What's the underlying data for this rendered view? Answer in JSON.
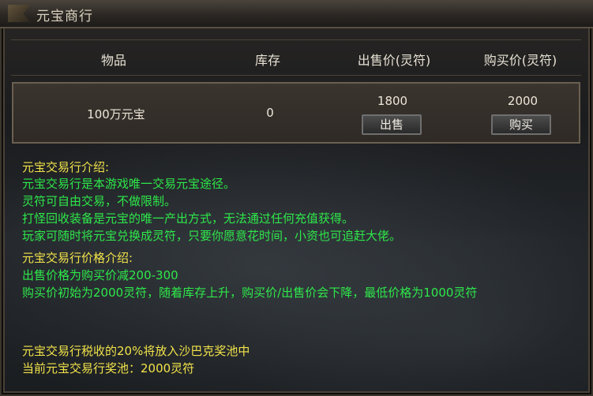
{
  "window": {
    "title": "元宝商行"
  },
  "table": {
    "headers": {
      "item": "物品",
      "stock": "库存",
      "sell_price": "出售价(灵符)",
      "buy_price": "购买价(灵符)"
    },
    "row": {
      "item": "100万元宝",
      "stock": "0",
      "sell_price": "1800",
      "buy_price": "2000",
      "sell_button": "出售",
      "buy_button": "购买"
    }
  },
  "intro": {
    "title": "元宝交易行介绍:",
    "lines": [
      "元宝交易行是本游戏唯一交易元宝途径。",
      "灵符可自由交易，不做限制。",
      "打怪回收装备是元宝的唯一产出方式，无法通过任何充值获得。",
      "玩家可随时将元宝兑换成灵符，只要你愿意花时间，小资也可追赶大佬。"
    ]
  },
  "price_intro": {
    "title": "元宝交易行价格介绍:",
    "lines": [
      "出售价格为购买价减200-300",
      "购买价初始为2000灵符，随着库存上升，购买价/出售价会下降，最低价格为1000灵符"
    ]
  },
  "footer": {
    "tax": "元宝交易行税收的20%将放入沙巴克奖池中",
    "pool": "当前元宝交易行奖池：2000灵符"
  },
  "colors": {
    "yellow_text": "#f2e34a",
    "green_text": "#2ee84a"
  }
}
